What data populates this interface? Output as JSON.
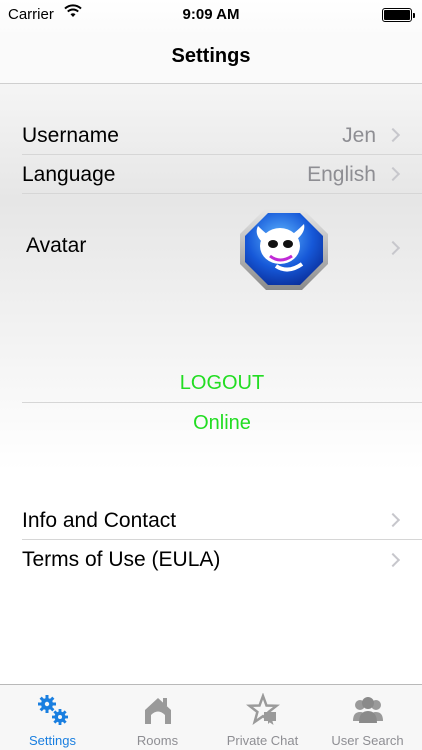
{
  "status": {
    "carrier": "Carrier",
    "time": "9:09 AM"
  },
  "nav": {
    "title": "Settings"
  },
  "settings": {
    "username": {
      "label": "Username",
      "value": "Jen"
    },
    "language": {
      "label": "Language",
      "value": "English"
    },
    "avatar": {
      "label": "Avatar"
    }
  },
  "session": {
    "logout_label": "LOGOUT",
    "status_text": "Online",
    "status_color": "#22dd22"
  },
  "info": {
    "contact_label": "Info and Contact",
    "terms_label": "Terms of Use (EULA)"
  },
  "tabs": [
    {
      "label": "Settings",
      "icon": "gears-icon",
      "active": true
    },
    {
      "label": "Rooms",
      "icon": "house-icon",
      "active": false
    },
    {
      "label": "Private Chat",
      "icon": "star-chat-icon",
      "active": false
    },
    {
      "label": "User Search",
      "icon": "users-icon",
      "active": false
    }
  ],
  "colors": {
    "accent": "#1a7fe0",
    "secondary_text": "#8e8e93",
    "chevron": "#c7c7cc"
  }
}
